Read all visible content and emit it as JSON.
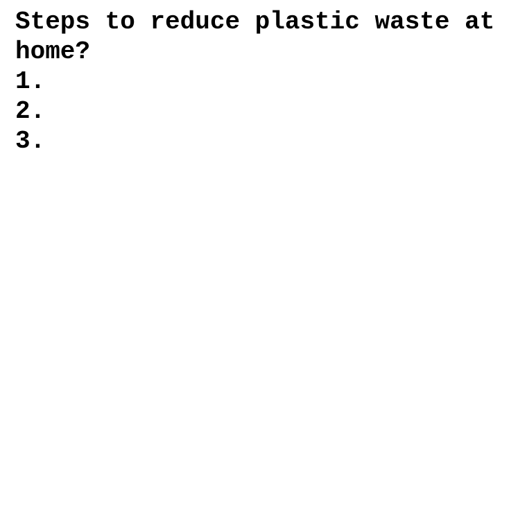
{
  "document": {
    "question": "Steps to reduce plastic waste at home?",
    "steps": [
      "1.",
      "2.",
      "3."
    ]
  }
}
